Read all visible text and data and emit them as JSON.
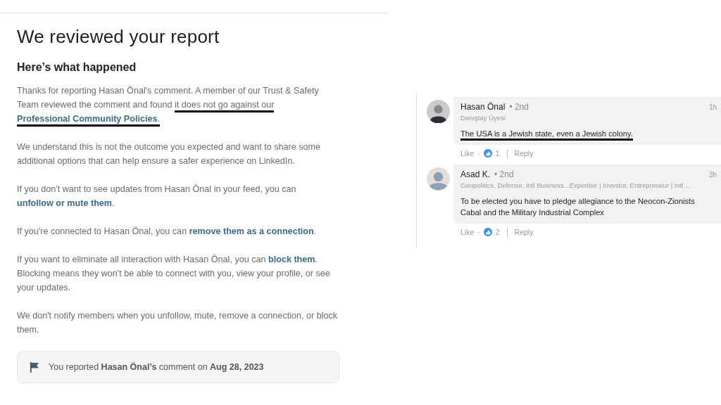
{
  "report": {
    "title": "We reviewed your report",
    "subtitle": "Here’s what happened",
    "paragraphs": [
      {
        "parts": [
          {
            "kind": "text",
            "text": "Thanks for reporting Hasan Önal's comment. A member of our Trust & Safety Team reviewed the comment and found ",
            "marked": false
          },
          {
            "kind": "text",
            "text": "it does not go against our ",
            "marked": true
          },
          {
            "kind": "link",
            "text": "Professional Community Policies",
            "marked": true
          },
          {
            "kind": "text",
            "text": ".",
            "marked": true
          }
        ]
      },
      {
        "parts": [
          {
            "kind": "text",
            "text": "We understand this is not the outcome you expected and want to share some additional options that can help ensure a safer experience on LinkedIn."
          }
        ]
      },
      {
        "parts": [
          {
            "kind": "text",
            "text": "If you don't want to see updates from Hasan Önal in your feed, you can "
          },
          {
            "kind": "link",
            "text": "unfollow or mute them"
          },
          {
            "kind": "text",
            "text": "."
          }
        ]
      },
      {
        "parts": [
          {
            "kind": "text",
            "text": "If you're connected to Hasan Önal, you can "
          },
          {
            "kind": "link",
            "text": "remove them as a connection"
          },
          {
            "kind": "text",
            "text": "."
          }
        ]
      },
      {
        "parts": [
          {
            "kind": "text",
            "text": "If you want to eliminate all interaction with Hasan Önal, you can "
          },
          {
            "kind": "link",
            "text": "block them"
          },
          {
            "kind": "text",
            "text": ". Blocking means they won't be able to connect with you, view your profile, or see your updates."
          }
        ]
      },
      {
        "parts": [
          {
            "kind": "text",
            "text": "We don't notify members when you unfollow, mute, remove a connection, or block them."
          }
        ]
      }
    ],
    "notice": "You reported **Hasan Önal’s** comment on **Aug 28, 2023**"
  },
  "comments": [
    {
      "author": "Hasan Önal",
      "degree": "• 2nd",
      "headline": "Danıştay Üyesi",
      "time": "1h",
      "text": "The USA is a Jewish state, even a Jewish colony.",
      "marked": true,
      "like": "Like",
      "separator": "·",
      "reactions": "1",
      "reply": "Reply"
    },
    {
      "author": "Asad K.",
      "degree": "• 2nd",
      "headline": "Geopolitics, Defense, Intl Business...Expertise | Investor, Entrepreneur | Intl ...",
      "time": "3h",
      "text": "To be elected you have to pledge allegiance to the Neocon-Zionists Cabal and the Military Industrial Complex",
      "marked": false,
      "like": "Like",
      "separator": "·",
      "reactions": "2",
      "reply": "Reply"
    }
  ]
}
